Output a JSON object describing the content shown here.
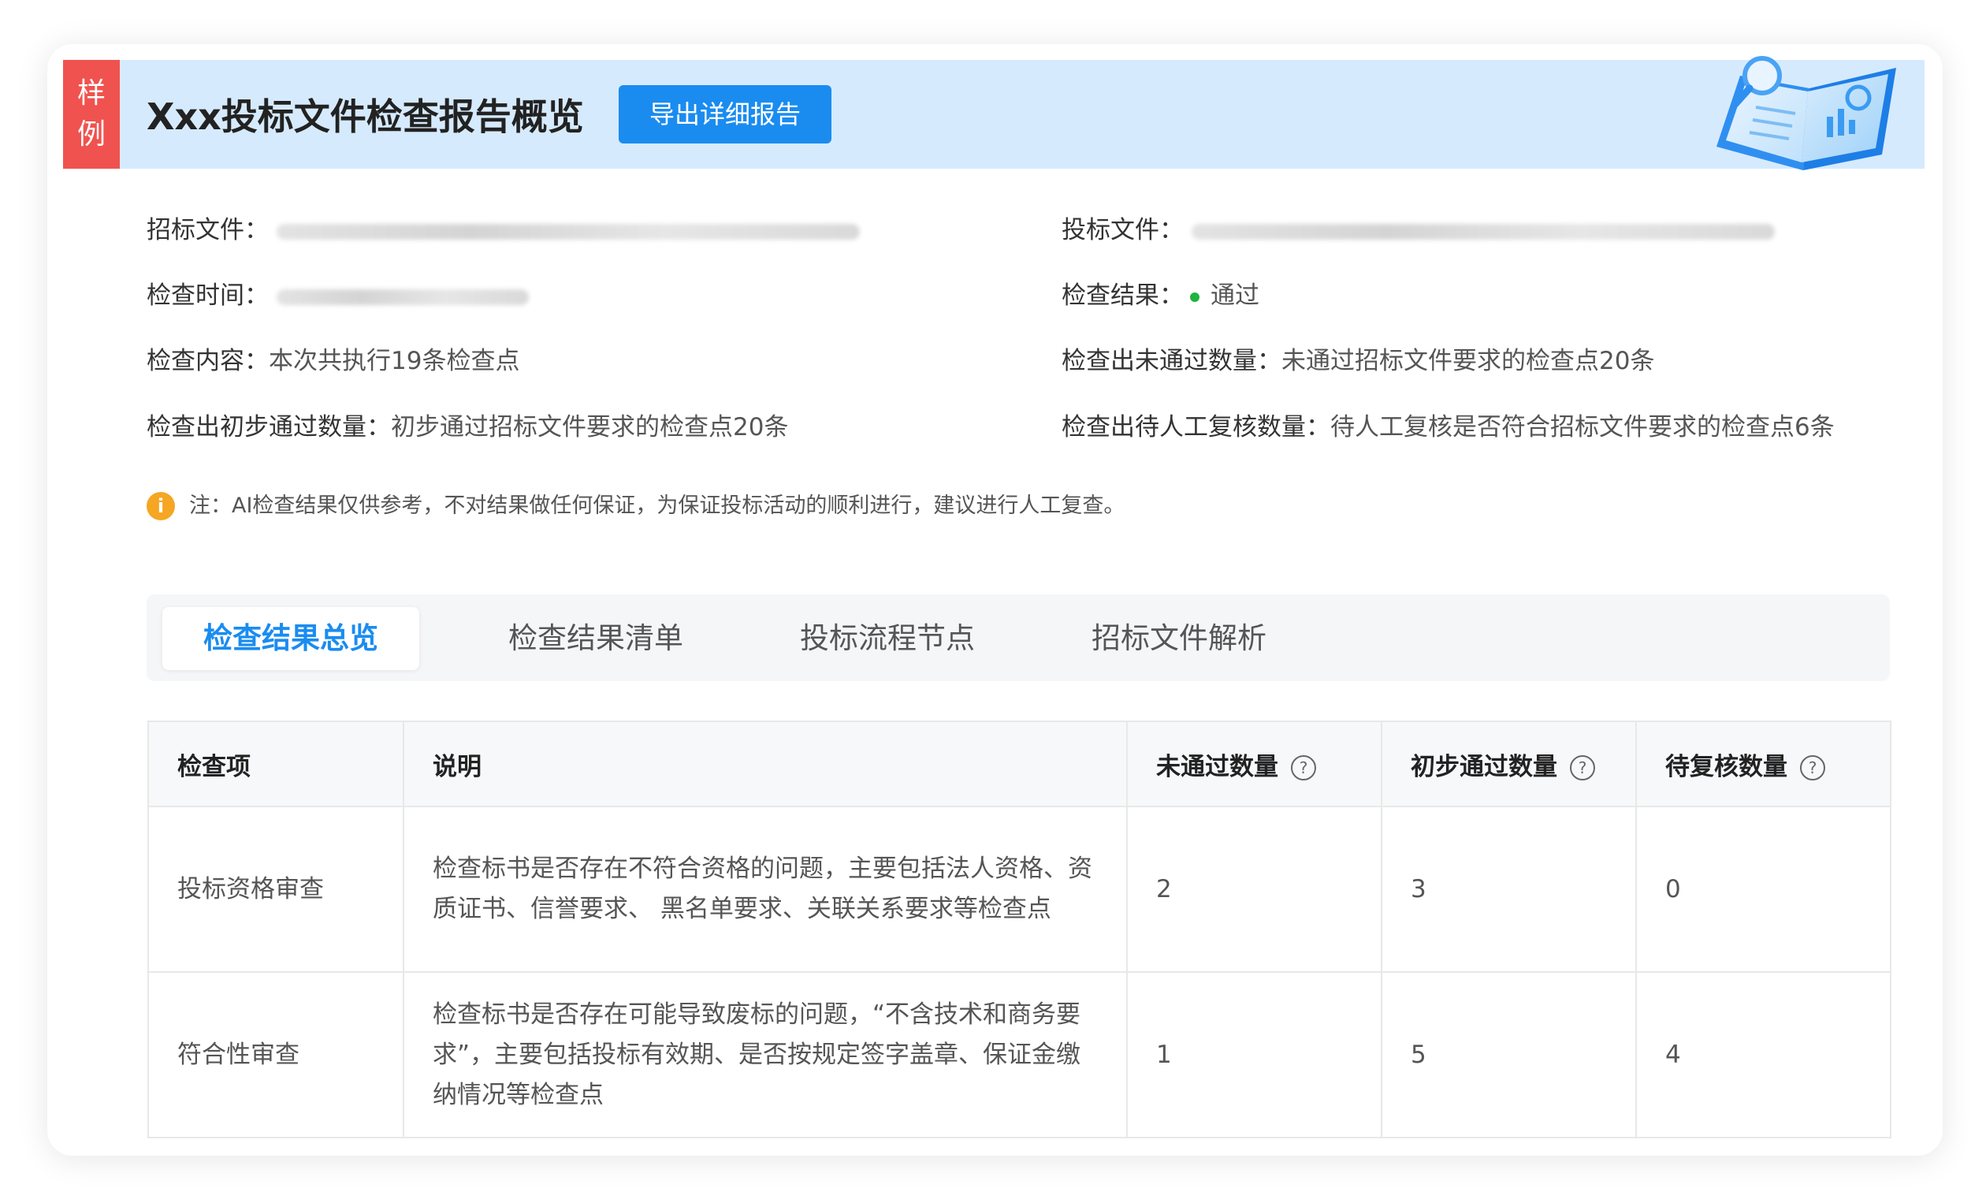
{
  "badge": {
    "line1": "样",
    "line2": "例"
  },
  "header": {
    "title": "Xxx投标文件检查报告概览",
    "export_label": "导出详细报告"
  },
  "info": {
    "tender_doc_label": "招标文件：",
    "bid_doc_label": "投标文件：",
    "check_time_label": "检查时间：",
    "check_result_label": "检查结果：",
    "check_result_value": "通过",
    "check_content_label": "检查内容：",
    "check_content_value": "本次共执行19条检查点",
    "failed_count_label": "检查出未通过数量：",
    "failed_count_value": "未通过招标文件要求的检查点20条",
    "passed_count_label": "检查出初步通过数量：",
    "passed_count_value": "初步通过招标文件要求的检查点20条",
    "pending_count_label": "检查出待人工复核数量：",
    "pending_count_value": "待人工复核是否符合招标文件要求的检查点6条"
  },
  "note": {
    "icon_char": "i",
    "text": "注：AI检查结果仅供参考，不对结果做任何保证，为保证投标活动的顺利进行，建议进行人工复查。"
  },
  "tabs": [
    {
      "label": "检查结果总览",
      "active": true
    },
    {
      "label": "检查结果清单",
      "active": false
    },
    {
      "label": "投标流程节点",
      "active": false
    },
    {
      "label": "招标文件解析",
      "active": false
    }
  ],
  "table": {
    "headers": [
      "检查项",
      "说明",
      "未通过数量",
      "初步通过数量",
      "待复核数量"
    ],
    "help_char": "?",
    "rows": [
      {
        "item": "投标资格审查",
        "desc": "检查标书是否存在不符合资格的问题，主要包括法人资格、资质证书、信誉要求、 黑名单要求、关联关系要求等检查点",
        "failed": "2",
        "passed": "3",
        "pending": "0"
      },
      {
        "item": "符合性审查",
        "desc": "检查标书是否存在可能导致废标的问题，“不含技术和商务要求”，主要包括投标有效期、是否按规定签字盖章、保证金缴纳情况等检查点",
        "failed": "1",
        "passed": "5",
        "pending": "4"
      }
    ]
  },
  "colors": {
    "accent": "#1a8cf0",
    "header_bg": "#d6eafd",
    "badge_bg": "#f0524f",
    "status_pass": "#1fb33f",
    "note_icon": "#f5a623"
  },
  "icons": {
    "illustration": "open-book-magnifier-icon",
    "note": "info-circle-icon",
    "help": "question-circle-icon",
    "status": "status-dot-icon"
  }
}
